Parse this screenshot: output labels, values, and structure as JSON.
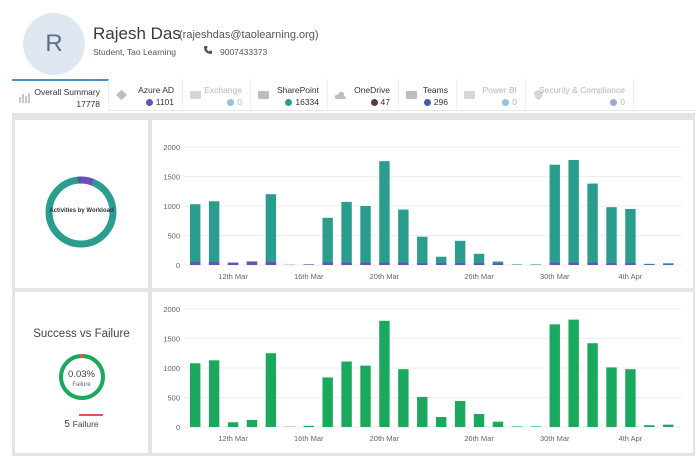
{
  "user": {
    "avatar_letter": "R",
    "name": "Rajesh Das",
    "email": "(rajeshdas@taolearning.org)",
    "role": "Student, Tao Learning",
    "phone": "9007433373"
  },
  "tabs": [
    {
      "label": "Overall Summary",
      "count": "17778",
      "icon": "bar-chart-icon",
      "state": "active",
      "dot": null
    },
    {
      "label": "Azure AD",
      "count": "1101",
      "icon": "azure-icon",
      "state": "enabled",
      "dot": "#6b4fb8"
    },
    {
      "label": "Exchange",
      "count": "0",
      "icon": "exchange-icon",
      "state": "disabled",
      "dot": "#8fc3e6"
    },
    {
      "label": "SharePoint",
      "count": "16334",
      "icon": "sharepoint-icon",
      "state": "enabled",
      "dot": "#2a9d8f"
    },
    {
      "label": "OneDrive",
      "count": "47",
      "icon": "cloud-icon",
      "state": "enabled",
      "dot": "#5a3e3e"
    },
    {
      "label": "Teams",
      "count": "296",
      "icon": "teams-icon",
      "state": "enabled",
      "dot": "#4a56a6"
    },
    {
      "label": "Power BI",
      "count": "0",
      "icon": "powerbi-icon",
      "state": "disabled",
      "dot": "#8fc3e6"
    },
    {
      "label": "Security & Compliance",
      "count": "0",
      "icon": "shield-icon",
      "state": "disabled",
      "dot": "#9aa7dc"
    }
  ],
  "workload_panel": {
    "donut_label": "Activities by Workload"
  },
  "success_panel": {
    "title": "Success vs Failure",
    "percent": "0.03%",
    "percent_label": "Failure",
    "failure_count": "5",
    "failure_word": "Failure"
  },
  "colors": {
    "teal": "#2a9d8f",
    "purple": "#6b4fb8",
    "green": "#1aa85c",
    "red": "#e05555",
    "grid": "#eeeeee"
  },
  "chart_data": [
    {
      "type": "bar",
      "title": "",
      "ylim": [
        0,
        2000
      ],
      "yticks": [
        "2000",
        "1500",
        "1000",
        "500",
        "0"
      ],
      "xticks": [
        "12th Mar",
        "16th Mar",
        "20th Mar",
        "26th Mar",
        "30th Mar",
        "4th Apr",
        "8th Apr"
      ],
      "series": [
        {
          "color": "#2a9d8f",
          "values": [
            1030,
            1080,
            40,
            60,
            1200,
            5,
            10,
            800,
            1070,
            1000,
            1760,
            940,
            480,
            140,
            410,
            190,
            60,
            10,
            10,
            1700,
            1780,
            1380,
            980,
            950,
            20,
            30
          ]
        },
        {
          "color": "#6b4fb8",
          "values": [
            50,
            50,
            40,
            60,
            50,
            0,
            10,
            40,
            40,
            40,
            40,
            40,
            30,
            30,
            30,
            30,
            30,
            0,
            0,
            40,
            40,
            40,
            30,
            30,
            10,
            10
          ]
        }
      ]
    },
    {
      "type": "bar",
      "title": "",
      "ylim": [
        0,
        2000
      ],
      "yticks": [
        "2000",
        "1500",
        "1000",
        "500",
        "0"
      ],
      "xticks": [
        "12th Mar",
        "16th Mar",
        "20th Mar",
        "26th Mar",
        "30th Mar",
        "4th Apr",
        "8th Apr"
      ],
      "series": [
        {
          "color": "#1aa85c",
          "values": [
            1080,
            1130,
            80,
            120,
            1250,
            5,
            20,
            840,
            1110,
            1040,
            1800,
            980,
            510,
            170,
            440,
            220,
            90,
            10,
            10,
            1740,
            1820,
            1420,
            1010,
            980,
            30,
            40
          ]
        }
      ]
    }
  ]
}
